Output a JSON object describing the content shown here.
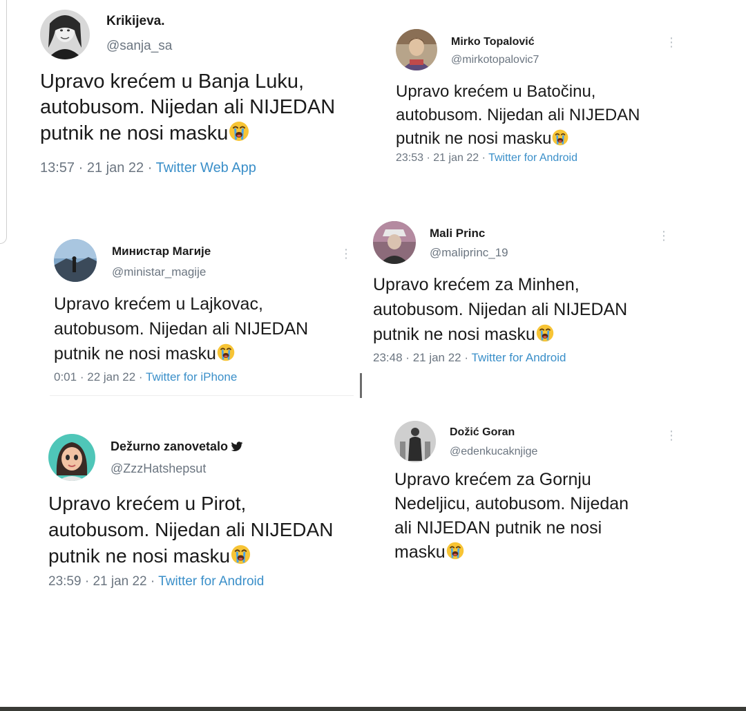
{
  "tweets": [
    {
      "name": "Krikijeva.",
      "handle": "@sanja_sa",
      "lines": [
        "Upravo krećem u Banja Luku,",
        "autobusom. Nijedan ali NIJEDAN",
        "putnik ne nosi masku"
      ],
      "time": "13:57",
      "date": "21 jan 22",
      "source": "Twitter Web App",
      "avatar_icon": "woman-selfie-avatar"
    },
    {
      "name": "Mirko Topalović",
      "handle": "@mirkotopalovic7",
      "lines": [
        "Upravo krećem u Batočinu,",
        "autobusom. Nijedan ali NIJEDAN",
        "putnik ne nosi masku"
      ],
      "time": "23:53",
      "date": "21 jan 22",
      "source": "Twitter for Android",
      "avatar_icon": "man-portrait-avatar"
    },
    {
      "name": "Министар Магије",
      "handle": "@ministar_magije",
      "lines": [
        "Upravo krećem u Lajkovac,",
        "autobusom. Nijedan ali NIJEDAN",
        "putnik ne nosi masku"
      ],
      "time": "0:01",
      "date": "22 jan 22",
      "source": "Twitter for iPhone",
      "avatar_icon": "landscape-avatar"
    },
    {
      "name": "Mali Princ",
      "handle": "@maliprinc_19",
      "lines": [
        "Upravo krećem za Minhen,",
        "autobusom. Nijedan ali NIJEDAN",
        "putnik ne nosi masku"
      ],
      "time": "23:48",
      "date": "21 jan 22",
      "source": "Twitter for Android",
      "avatar_icon": "hat-figure-avatar"
    },
    {
      "name": "Dežurno zanovetalo",
      "handle": "@ZzzHatshepsut",
      "lines": [
        "Upravo krećem u Pirot,",
        "autobusom. Nijedan ali NIJEDAN",
        "putnik ne nosi masku"
      ],
      "time": "23:59",
      "date": "21 jan 22",
      "source": "Twitter for Android",
      "avatar_icon": "cartoon-girl-avatar"
    },
    {
      "name": "Dožić Goran",
      "handle": "@edenkucaknjige",
      "lines": [
        "Upravo krećem za Gornju",
        "Nedeljicu, autobusom. Nijedan",
        "ali NIJEDAN putnik ne nosi",
        "masku"
      ],
      "avatar_icon": "statue-avatar"
    }
  ],
  "separator": "·",
  "emoji": "crying-face-emoji",
  "more_icon": "more-dots-icon",
  "verified_icon": "twitter-bird-icon",
  "colors": {
    "source_link": "#3a8fc9",
    "meta_text": "#6b7580",
    "bottom_bar": "#3a3b36"
  }
}
